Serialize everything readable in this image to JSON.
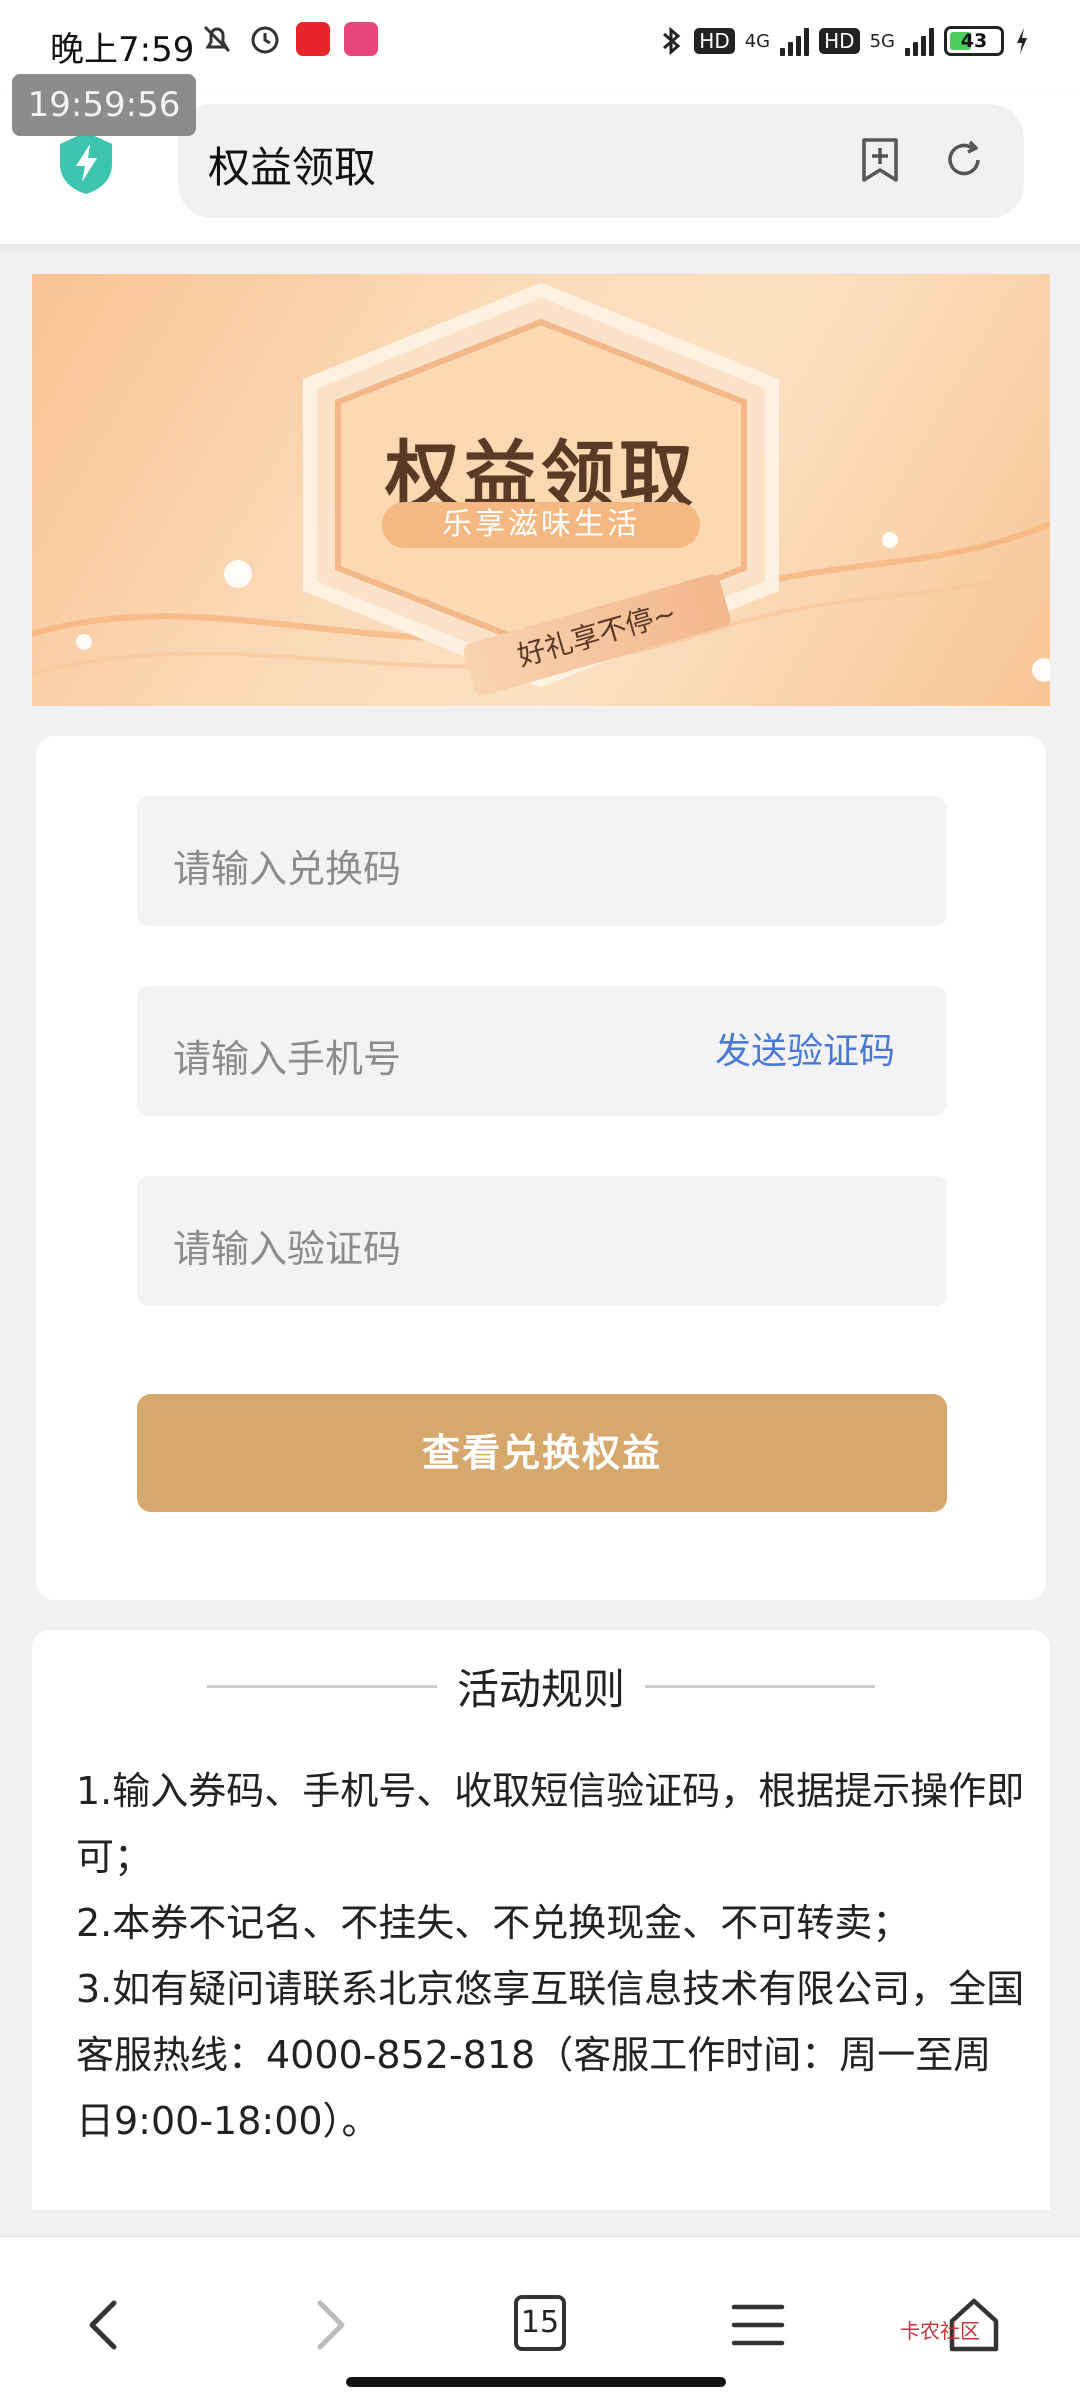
{
  "status_bar": {
    "time": "晚上7:59",
    "network_4g": "4G",
    "network_5g": "5G",
    "hd_label": "HD",
    "battery": "43",
    "battery_level": 0.43
  },
  "overlay_clock": "19:59:56",
  "browser": {
    "page_title": "权益领取",
    "icons": [
      "shield-icon",
      "bookmark-add-icon",
      "refresh-icon"
    ]
  },
  "banner": {
    "title": "权益领取",
    "subtitle": "乐享滋味生活",
    "ribbon": "好礼享不停~"
  },
  "form": {
    "code_placeholder": "请输入兑换码",
    "phone_placeholder": "请输入手机号",
    "send_code_label": "发送验证码",
    "verify_placeholder": "请输入验证码",
    "submit_label": "查看兑换权益",
    "accent_color": "#d6a86c",
    "link_color": "#4a78d5"
  },
  "rules": {
    "title": "活动规则",
    "items": [
      "1.输入券码、手机号、收取短信验证码，根据提示操作即可；",
      "2.本券不记名、不挂失、不兑换现金、不可转卖；",
      "3.如有疑问请联系北京悠享互联信息技术有限公司，全国客服热线：4000-852-818（客服工作时间：周一至周日9:00-18:00）。"
    ]
  },
  "bottom_nav": {
    "tabs_count": "15",
    "icons": [
      "back-icon",
      "forward-icon",
      "tabs-icon",
      "menu-icon",
      "home-icon"
    ],
    "watermark": "卡农社区"
  }
}
